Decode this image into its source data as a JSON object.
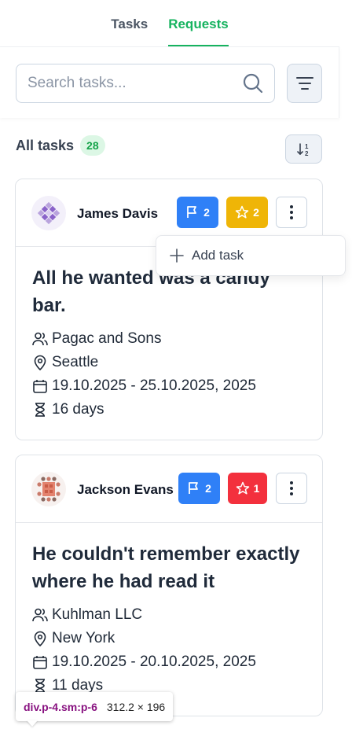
{
  "tabs": [
    {
      "label": "Tasks",
      "active": false
    },
    {
      "label": "Requests",
      "active": true
    }
  ],
  "search": {
    "placeholder": "Search tasks..."
  },
  "list": {
    "title": "All tasks",
    "count": "28"
  },
  "menu": {
    "add_task": "Add task"
  },
  "cards": [
    {
      "name": "James Davis",
      "flags": "2",
      "stars": "2",
      "star_color": "yellow",
      "title": "All he wanted was a candy bar.",
      "company": "Pagac and Sons",
      "city": "Seattle",
      "dates": "19.10.2025 - 25.10.2025, 2025",
      "duration": "16 days"
    },
    {
      "name": "Jackson Evans",
      "flags": "2",
      "stars": "1",
      "star_color": "red",
      "title": "He couldn't remember exactly where he had read it",
      "company": "Kuhlman LLC",
      "city": "New York",
      "dates": "19.10.2025 - 20.10.2025, 2025",
      "duration": "11 days"
    }
  ],
  "inspector": {
    "selector": "div.p-4.sm:p-6",
    "size": "312.2 × 196"
  },
  "colors": {
    "accent": "#16b35f",
    "blue": "#2f80f7",
    "yellow": "#efb507",
    "red": "#f3303d"
  }
}
